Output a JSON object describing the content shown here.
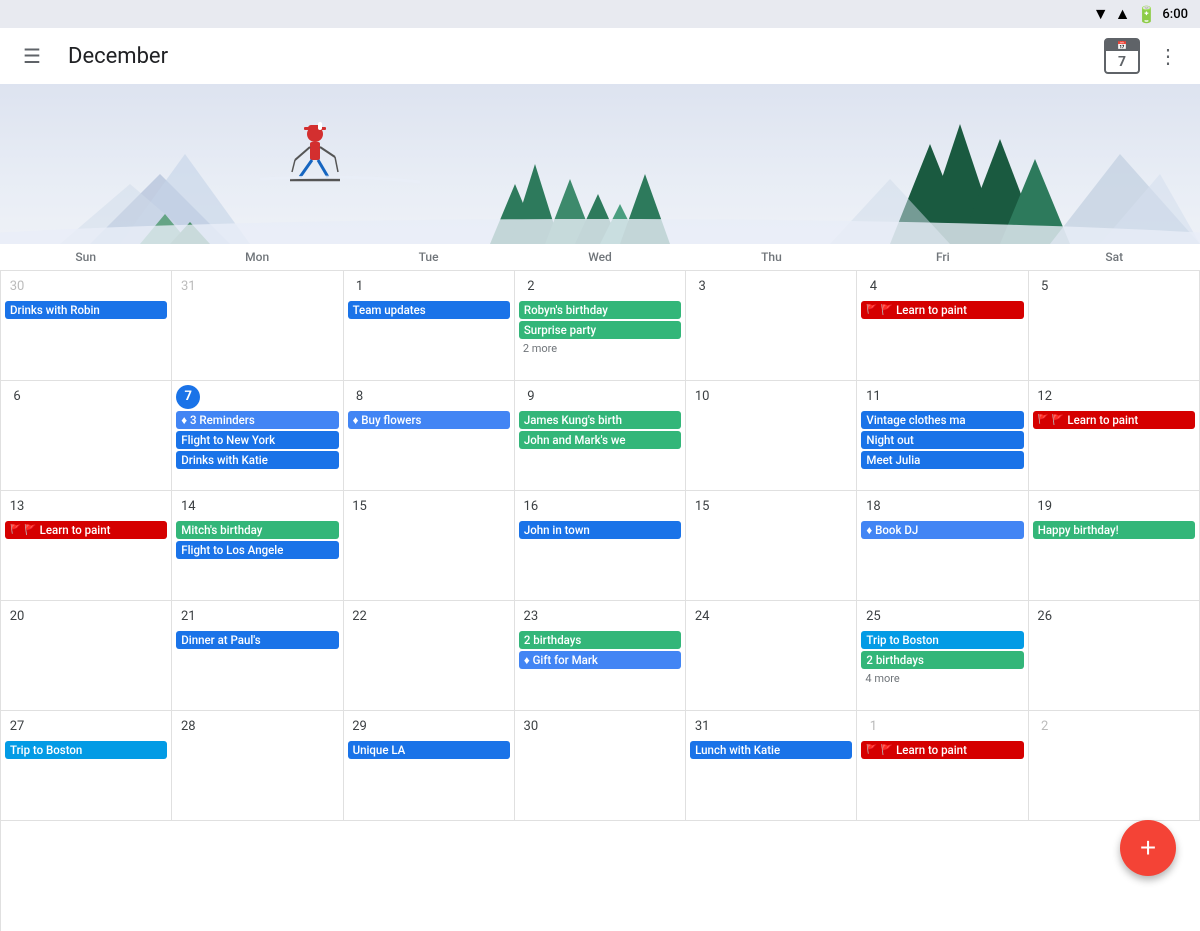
{
  "statusBar": {
    "time": "6:00",
    "icons": [
      "wifi",
      "signal",
      "battery"
    ]
  },
  "header": {
    "menuLabel": "☰",
    "title": "December",
    "calendarIconTop": "",
    "calendarIconNum": "7",
    "moreLabel": "⋮"
  },
  "dayHeaders": [
    "Sun",
    "Mon",
    "Tue",
    "Wed",
    "Thu",
    "Fri",
    "Sat"
  ],
  "weeks": [
    {
      "days": [
        {
          "date": "30",
          "otherMonth": true,
          "events": [
            {
              "label": "Drinks with Robin",
              "color": "blue"
            }
          ]
        },
        {
          "date": "31",
          "otherMonth": true,
          "events": []
        },
        {
          "date": "1",
          "events": [
            {
              "label": "Team updates",
              "color": "blue"
            }
          ]
        },
        {
          "date": "2",
          "events": [
            {
              "label": "Robyn's birthday",
              "color": "green"
            },
            {
              "label": "Surprise party",
              "color": "green"
            },
            {
              "label": "2 more",
              "color": "more"
            }
          ]
        },
        {
          "date": "3",
          "events": []
        },
        {
          "date": "4",
          "events": [
            {
              "label": "Learn to paint",
              "color": "reminder"
            }
          ]
        },
        {
          "date": "5",
          "events": []
        }
      ]
    },
    {
      "days": [
        {
          "date": "6",
          "events": []
        },
        {
          "date": "7",
          "today": true,
          "events": [
            {
              "label": "♦ 3 Reminders",
              "color": "blue-light"
            },
            {
              "label": "Flight to New York",
              "color": "blue"
            },
            {
              "label": "Drinks with Katie",
              "color": "blue"
            }
          ]
        },
        {
          "date": "8",
          "events": [
            {
              "label": "♦ Buy flowers",
              "color": "blue-light"
            }
          ]
        },
        {
          "date": "9",
          "events": [
            {
              "label": "James Kung's birth",
              "color": "green"
            },
            {
              "label": "John and Mark's we",
              "color": "green"
            }
          ]
        },
        {
          "date": "10",
          "events": []
        },
        {
          "date": "11",
          "events": [
            {
              "label": "Vintage clothes ma",
              "color": "blue"
            },
            {
              "label": "Night out",
              "color": "blue"
            },
            {
              "label": "Meet Julia",
              "color": "blue"
            }
          ]
        },
        {
          "date": "12",
          "events": [
            {
              "label": "Learn to paint",
              "color": "reminder"
            }
          ]
        }
      ]
    },
    {
      "days": [
        {
          "date": "13",
          "events": [
            {
              "label": "Learn to paint",
              "color": "reminder"
            }
          ]
        },
        {
          "date": "14",
          "events": [
            {
              "label": "Mitch's birthday",
              "color": "green"
            },
            {
              "label": "Flight to Los Angele",
              "color": "blue"
            }
          ]
        },
        {
          "date": "15",
          "events": []
        },
        {
          "date": "16",
          "events": [
            {
              "label": "John in town",
              "color": "blue"
            }
          ]
        },
        {
          "date": "15",
          "events": []
        },
        {
          "date": "18",
          "events": [
            {
              "label": "♦ Book DJ",
              "color": "blue-light"
            }
          ]
        },
        {
          "date": "19",
          "events": [
            {
              "label": "Happy birthday!",
              "color": "green"
            }
          ]
        }
      ]
    },
    {
      "days": [
        {
          "date": "20",
          "events": []
        },
        {
          "date": "21",
          "events": [
            {
              "label": "Dinner at Paul's",
              "color": "blue"
            }
          ]
        },
        {
          "date": "22",
          "events": []
        },
        {
          "date": "23",
          "events": [
            {
              "label": "2 birthdays",
              "color": "green"
            },
            {
              "label": "♦ Gift for Mark",
              "color": "blue-light"
            }
          ]
        },
        {
          "date": "24",
          "events": []
        },
        {
          "date": "25",
          "events": [
            {
              "label": "Trip to Boston",
              "color": "teal"
            },
            {
              "label": "2 birthdays",
              "color": "green"
            },
            {
              "label": "4 more",
              "color": "more"
            }
          ]
        },
        {
          "date": "26",
          "events": []
        }
      ]
    },
    {
      "days": [
        {
          "date": "27",
          "events": [
            {
              "label": "Trip to Boston",
              "color": "teal"
            }
          ]
        },
        {
          "date": "28",
          "events": []
        },
        {
          "date": "29",
          "events": [
            {
              "label": "Unique LA",
              "color": "blue"
            }
          ]
        },
        {
          "date": "30",
          "events": []
        },
        {
          "date": "31",
          "events": [
            {
              "label": "Lunch with Katie",
              "color": "blue"
            }
          ]
        },
        {
          "date": "1",
          "otherMonth": true,
          "events": [
            {
              "label": "Learn to paint",
              "color": "reminder"
            }
          ]
        },
        {
          "date": "2",
          "otherMonth": true,
          "events": []
        }
      ]
    }
  ],
  "fab": {
    "label": "+"
  }
}
